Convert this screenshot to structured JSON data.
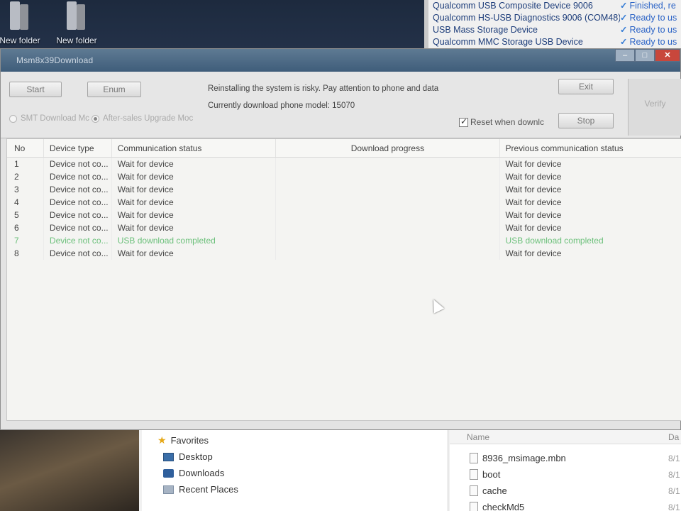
{
  "desktop": {
    "icons": [
      {
        "label": "New folder"
      },
      {
        "label": "New folder"
      }
    ]
  },
  "device_list": [
    {
      "name": "Qualcomm USB Composite Device 9006",
      "status": "Finished, re"
    },
    {
      "name": "Qualcomm HS-USB Diagnostics 9006 (COM48)",
      "status": "Ready to us"
    },
    {
      "name": "USB Mass Storage Device",
      "status": "Ready to us"
    },
    {
      "name": "Qualcomm MMC Storage USB Device",
      "status": "Ready to us"
    }
  ],
  "window": {
    "title": "Msm8x39Download",
    "buttons": {
      "start": "Start",
      "enum": "Enum",
      "exit": "Exit",
      "stop": "Stop",
      "verify": "Verify"
    },
    "notice": "Reinstalling the system is risky. Pay attention to phone and data",
    "model_line": "Currently download phone model: 15070",
    "modes": {
      "smt": "SMT Download Mc",
      "after_sales": "After-sales Upgrade Moc"
    },
    "reset_label": "Reset when downlc"
  },
  "table": {
    "headers": {
      "no": "No",
      "device_type": "Device type",
      "comm_status": "Communication status",
      "progress": "Download progress",
      "prev_status": "Previous communication status"
    },
    "rows": [
      {
        "no": "1",
        "type": "Device not co...",
        "comm": "Wait for device",
        "progress": "",
        "prev": "Wait for device"
      },
      {
        "no": "2",
        "type": "Device not co...",
        "comm": "Wait for device",
        "progress": "",
        "prev": "Wait for device"
      },
      {
        "no": "3",
        "type": "Device not co...",
        "comm": "Wait for device",
        "progress": "",
        "prev": "Wait for device"
      },
      {
        "no": "4",
        "type": "Device not co...",
        "comm": "Wait for device",
        "progress": "",
        "prev": "Wait for device"
      },
      {
        "no": "5",
        "type": "Device not co...",
        "comm": "Wait for device",
        "progress": "",
        "prev": "Wait for device"
      },
      {
        "no": "6",
        "type": "Device not co...",
        "comm": "Wait for device",
        "progress": "",
        "prev": "Wait for device"
      },
      {
        "no": "7",
        "type": "Device not co...",
        "comm": "USB download completed",
        "progress": "",
        "prev": "USB download completed"
      },
      {
        "no": "8",
        "type": "Device not co...",
        "comm": "Wait for device",
        "progress": "",
        "prev": "Wait for device"
      }
    ]
  },
  "explorer": {
    "nav": {
      "favorites": "Favorites",
      "desktop": "Desktop",
      "downloads": "Downloads",
      "recent": "Recent Places"
    },
    "files_header": {
      "name": "Name",
      "date": "Da"
    },
    "files": [
      {
        "name": "8936_msimage.mbn",
        "date": "8/1"
      },
      {
        "name": "boot",
        "date": "8/1"
      },
      {
        "name": "cache",
        "date": "8/1"
      },
      {
        "name": "checkMd5",
        "date": "8/1"
      }
    ]
  },
  "colors": {
    "completed_text": "#6cc07b",
    "titlebar": "#4d6a86",
    "status_link": "#2b63c6"
  }
}
